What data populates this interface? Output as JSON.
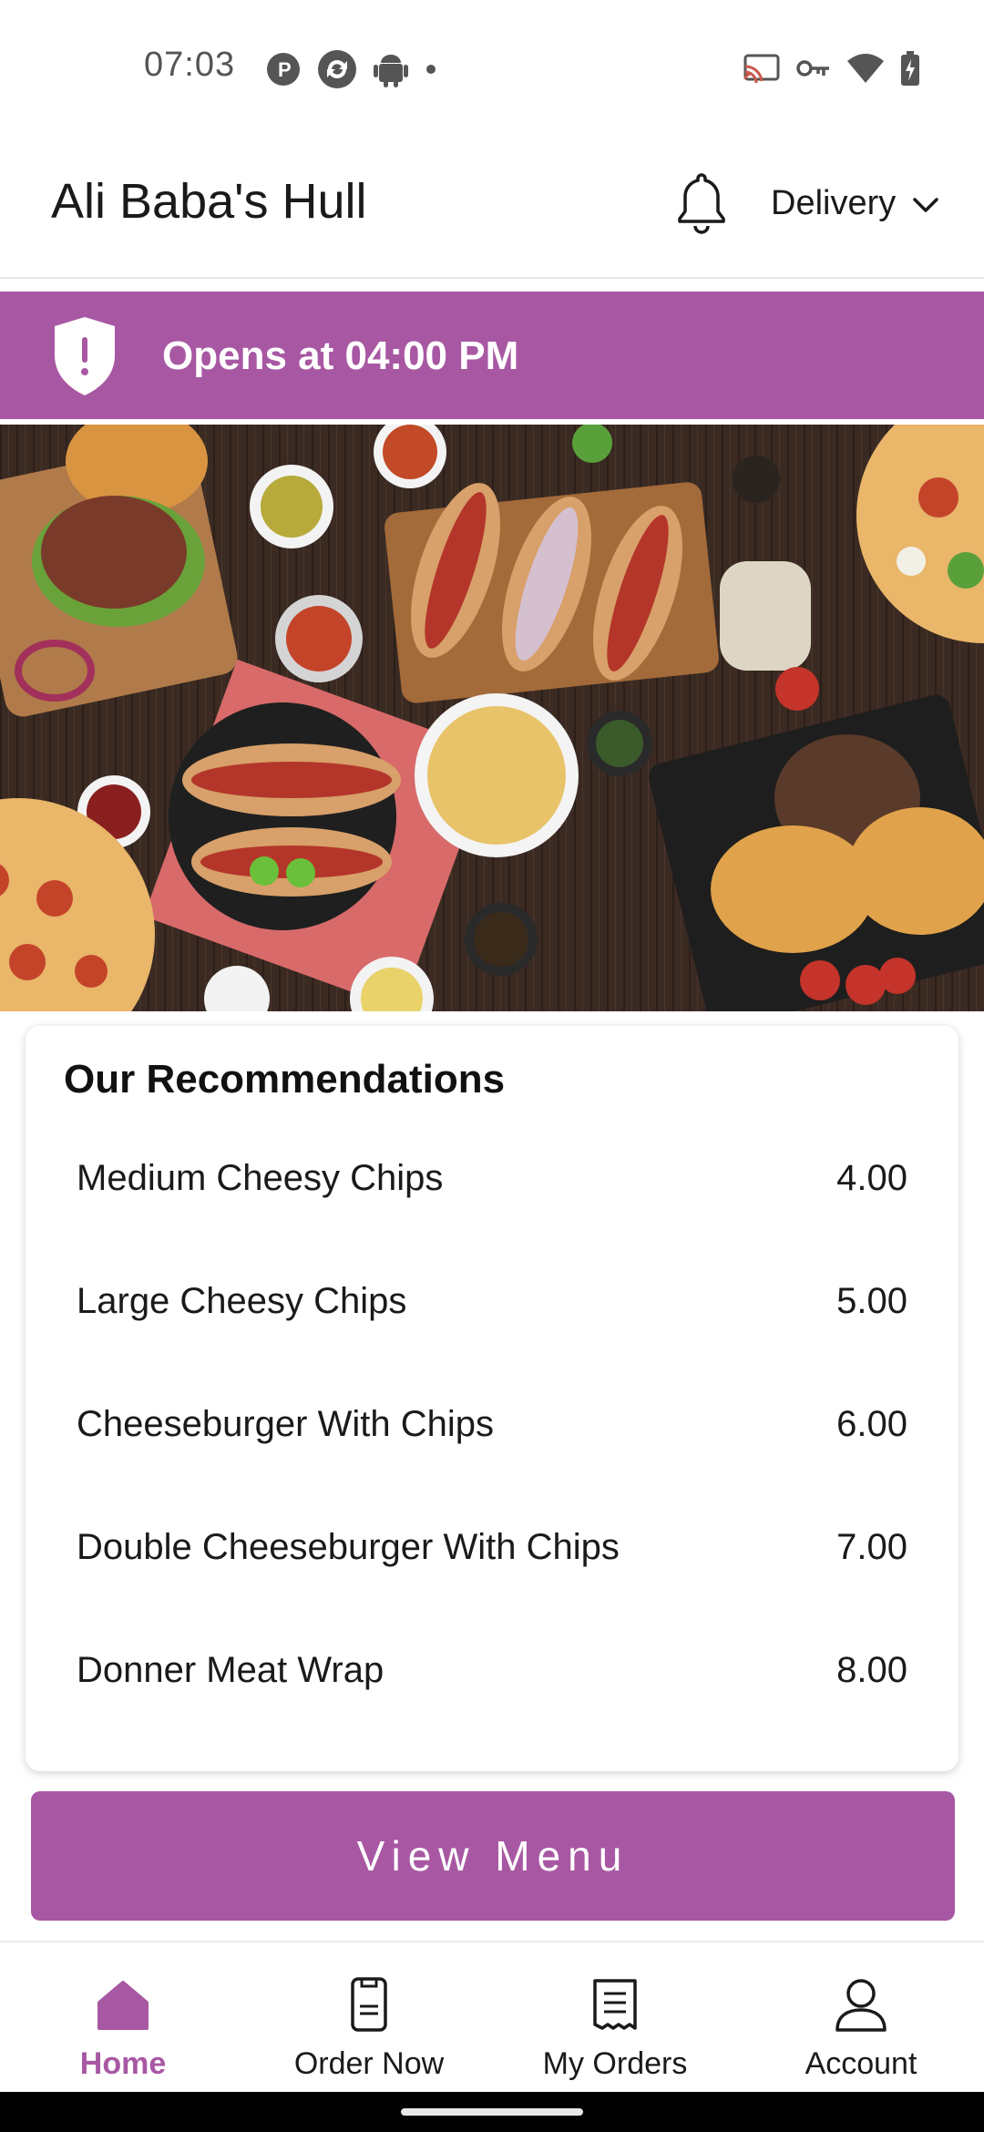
{
  "status_bar": {
    "time": "07:03",
    "left_icons": [
      "p-app-icon",
      "sync-app-icon",
      "android-icon",
      "dot-icon"
    ],
    "right_icons": [
      "cast-icon",
      "vpn-key-icon",
      "wifi-icon",
      "battery-charging-icon"
    ]
  },
  "header": {
    "title": "Ali Baba's Hull",
    "notification_icon": "bell-icon",
    "order_mode": "Delivery",
    "order_mode_icon": "chevron-down-icon"
  },
  "notice": {
    "icon": "shield-alert-icon",
    "text": "Opens at 04:00 PM"
  },
  "hero": {
    "image": "fast-food-spread"
  },
  "recommendations": {
    "title": "Our Recommendations",
    "items": [
      {
        "name": "Medium Cheesy Chips",
        "price": "4.00"
      },
      {
        "name": "Large Cheesy Chips",
        "price": "5.00"
      },
      {
        "name": "Cheeseburger With Chips",
        "price": "6.00"
      },
      {
        "name": "Double Cheeseburger With Chips",
        "price": "7.00"
      },
      {
        "name": "Donner Meat Wrap",
        "price": "8.00"
      }
    ]
  },
  "view_menu_label": "View Menu",
  "bottom_nav": {
    "items": [
      {
        "label": "Home",
        "icon": "home-icon",
        "active": true
      },
      {
        "label": "Order Now",
        "icon": "order-now-icon",
        "active": false
      },
      {
        "label": "My Orders",
        "icon": "receipt-icon",
        "active": false
      },
      {
        "label": "Account",
        "icon": "account-icon",
        "active": false
      }
    ]
  },
  "colors": {
    "accent": "#a858a3",
    "text": "#1a1a1a",
    "background": "#ffffff"
  }
}
